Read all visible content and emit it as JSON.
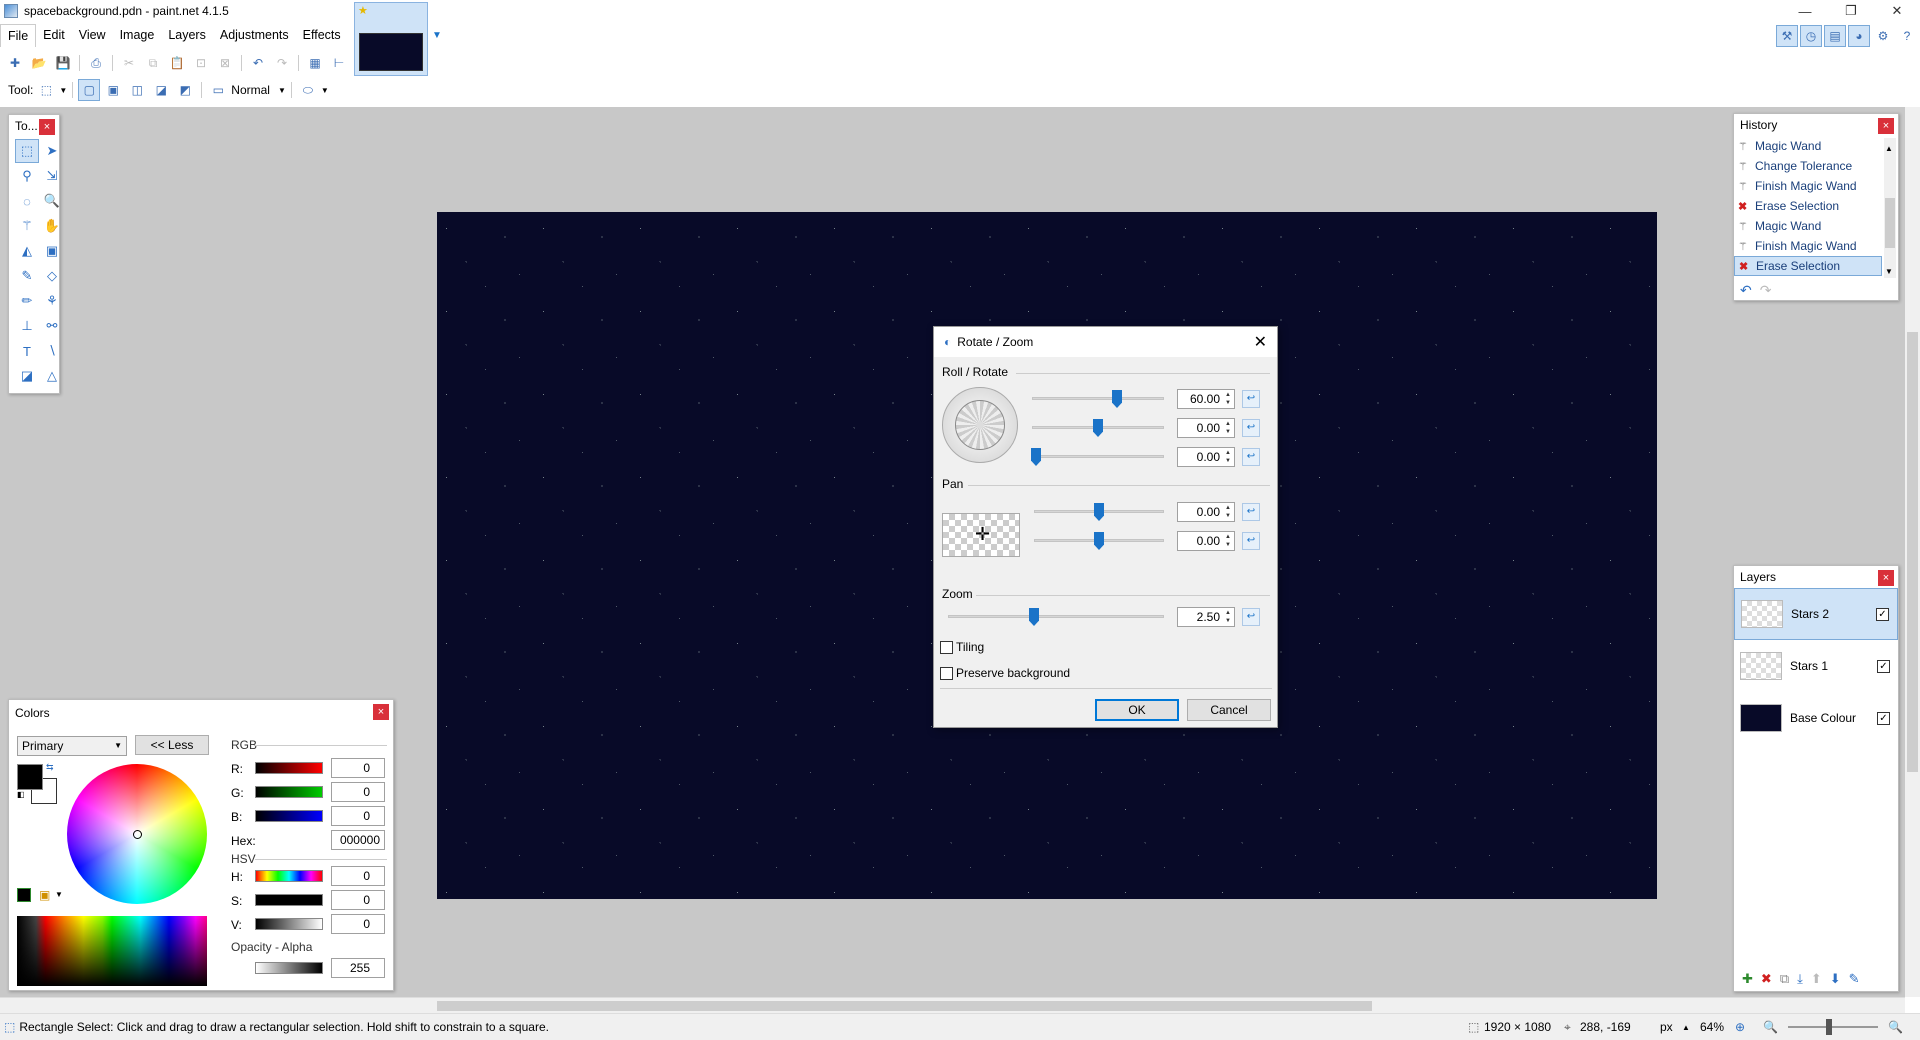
{
  "window": {
    "title": "spacebackground.pdn - paint.net 4.1.5",
    "minimize": "—",
    "maximize": "❐",
    "close": "✕"
  },
  "menu": [
    "File",
    "Edit",
    "View",
    "Image",
    "Layers",
    "Adjustments",
    "Effects"
  ],
  "toolbar": {
    "tool_label": "Tool:",
    "blend_mode": "Normal"
  },
  "tools_panel": {
    "title": "To..."
  },
  "history": {
    "title": "History",
    "items": [
      {
        "label": "Magic Wand",
        "icon": "magic-wand-icon"
      },
      {
        "label": "Change Tolerance",
        "icon": "magic-wand-icon"
      },
      {
        "label": "Finish Magic Wand",
        "icon": "magic-wand-icon"
      },
      {
        "label": "Erase Selection",
        "icon": "erase-x-icon"
      },
      {
        "label": "Magic Wand",
        "icon": "magic-wand-icon"
      },
      {
        "label": "Finish Magic Wand",
        "icon": "magic-wand-icon"
      },
      {
        "label": "Erase Selection",
        "icon": "erase-x-icon",
        "selected": true
      }
    ]
  },
  "layers": {
    "title": "Layers",
    "items": [
      {
        "name": "Stars 2",
        "selected": true,
        "visible": true,
        "thumb": "transparent"
      },
      {
        "name": "Stars 1",
        "visible": true,
        "thumb": "transparent"
      },
      {
        "name": "Base Colour",
        "visible": true,
        "thumb": "dark"
      }
    ]
  },
  "dialog": {
    "title": "Rotate / Zoom",
    "roll_rotate_label": "Roll / Rotate",
    "roll_values": [
      "60.00",
      "0.00",
      "0.00"
    ],
    "pan_label": "Pan",
    "pan_values": [
      "0.00",
      "0.00"
    ],
    "zoom_label": "Zoom",
    "zoom_value": "2.50",
    "tiling_label": "Tiling",
    "preserve_label": "Preserve background",
    "ok": "OK",
    "cancel": "Cancel"
  },
  "colors": {
    "title": "Colors",
    "mode": "Primary",
    "less_button": "<< Less",
    "rgb_label": "RGB",
    "r_label": "R:",
    "g_label": "G:",
    "b_label": "B:",
    "r": "0",
    "g": "0",
    "b": "0",
    "hex_label": "Hex:",
    "hex": "000000",
    "hsv_label": "HSV",
    "h_label": "H:",
    "s_label": "S:",
    "v_label": "V:",
    "h": "0",
    "s": "0",
    "v": "0",
    "opacity_label": "Opacity - Alpha",
    "alpha": "255"
  },
  "status": {
    "hint": "Rectangle Select: Click and drag to draw a rectangular selection. Hold shift to constrain to a square.",
    "image_size": "1920 × 1080",
    "cursor": "288, -169",
    "units": "px",
    "zoom": "64%"
  }
}
